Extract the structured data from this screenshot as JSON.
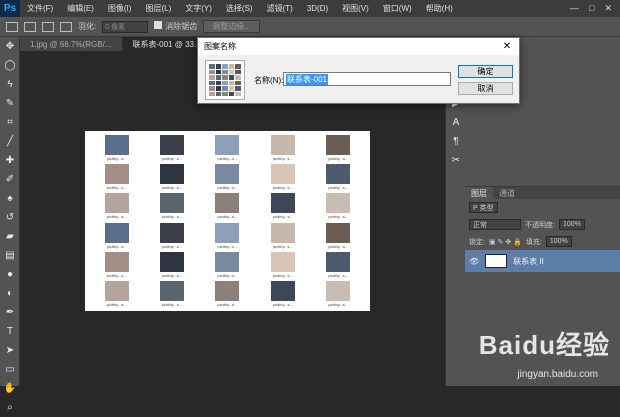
{
  "menubar": {
    "logo": "Ps",
    "items": [
      "文件(F)",
      "编辑(E)",
      "图像(I)",
      "图层(L)",
      "文字(Y)",
      "选择(S)",
      "滤镜(T)",
      "3D(D)",
      "视图(V)",
      "窗口(W)",
      "帮助(H)"
    ],
    "controls": [
      "—",
      "□",
      "✕"
    ]
  },
  "options": {
    "feather_label": "羽化:",
    "feather_value": "0 像素",
    "antialias_label": "消除锯齿",
    "refine_button": "调整边缘..."
  },
  "tabs": [
    "1.jpg @ 66.7%(RGB/...",
    "联系表-001 @ 33.3% (..."
  ],
  "doc": {
    "caption": "pictthy...s...",
    "photo_colors": [
      "#5a6f8c",
      "#3d3f4a",
      "#8ca0bd",
      "#c7b7aa",
      "#6b5d53",
      "#a48f86",
      "#2e3440",
      "#7b8aa3",
      "#d8c5b8",
      "#4d5a6e",
      "#b5a49b",
      "#59656f",
      "#8e7f7a",
      "#3c4858",
      "#c9bdb2"
    ]
  },
  "dialog": {
    "title": "图案名称",
    "close": "✕",
    "name_label": "名称(N):",
    "name_value": "联系表-001",
    "ok": "确定",
    "cancel": "取消"
  },
  "layers_panel": {
    "tabs": [
      "图层",
      "通道"
    ],
    "kind_label": "P 类型",
    "blend_mode": "正常",
    "opacity_label": "不透明度:",
    "opacity_value": "100%",
    "lock_label": "锁定:",
    "fill_label": "填充:",
    "fill_value": "100%",
    "layer_name": "联系表 II"
  },
  "watermark": {
    "brand": "Baidu经验",
    "url": "jingyan.baidu.com"
  }
}
